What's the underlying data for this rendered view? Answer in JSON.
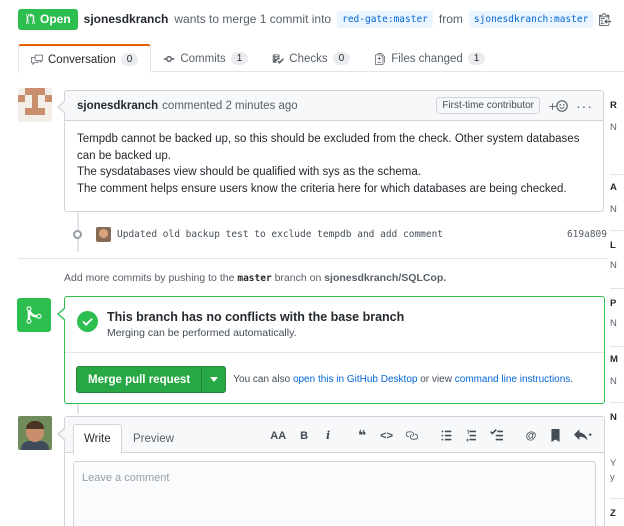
{
  "header": {
    "state": "Open",
    "author": "sjonesdkranch",
    "action_text": "wants to merge 1 commit into",
    "base_branch": "red-gate:master",
    "from_text": "from",
    "head_branch": "sjonesdkranch:master"
  },
  "tabs": [
    {
      "label": "Conversation",
      "count": "0"
    },
    {
      "label": "Commits",
      "count": "1"
    },
    {
      "label": "Checks",
      "count": "0"
    },
    {
      "label": "Files changed",
      "count": "1"
    }
  ],
  "comment": {
    "author": "sjonesdkranch",
    "time_text": "commented 2 minutes ago",
    "badge": "First-time contributor",
    "body": [
      "Tempdb cannot be backed up, so this should be excluded from the check. Other system databases can be backed up.",
      "The sysdatabases view should be qualified with sys as the schema.",
      "The comment helps ensure users know the criteria here for which databases are being checked."
    ]
  },
  "commit": {
    "message": "Updated old backup test to exclude tempdb and add comment",
    "sha": "619a809"
  },
  "add_commits": {
    "prefix": "Add more commits by pushing to the",
    "branch": "master",
    "middle": "branch on",
    "repo": "sjonesdkranch/SQLCop."
  },
  "merge": {
    "title": "This branch has no conflicts with the base branch",
    "subtitle": "Merging can be performed automatically.",
    "button_label": "Merge pull request",
    "alt_prefix": "You can also",
    "alt_link1": "open this in GitHub Desktop",
    "alt_middle": "or view",
    "alt_link2": "command line instructions",
    "alt_suffix": "."
  },
  "editor": {
    "write_tab": "Write",
    "preview_tab": "Preview",
    "placeholder": "Leave a comment",
    "toolbar": {
      "heading": "AA",
      "bold": "B",
      "italic": "i",
      "quote": "❝",
      "code": "<>",
      "at": "@"
    }
  },
  "sidebar": {
    "letters": [
      "R",
      "N",
      "A",
      "N",
      "L",
      "N",
      "P",
      "N",
      "M",
      "N",
      "N",
      "Y",
      "y",
      "Z"
    ]
  },
  "colors": {
    "green": "#2cbe4e",
    "link_blue": "#0366d6",
    "tab_accent": "#e36209"
  }
}
